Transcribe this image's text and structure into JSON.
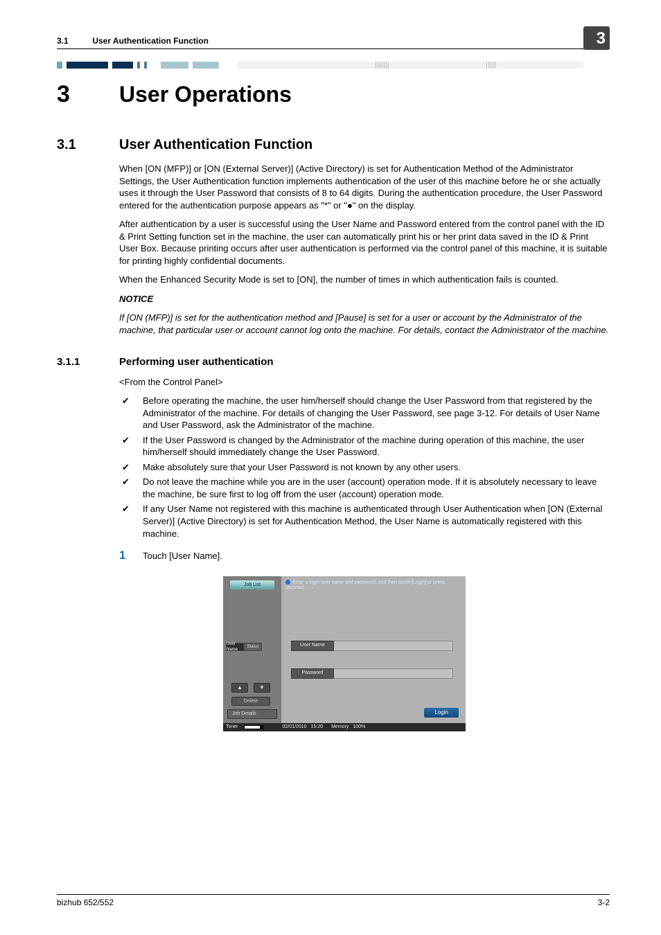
{
  "runhead": {
    "section_num": "3.1",
    "section_title": "User Authentication Function",
    "chapter_tab": "3"
  },
  "h1": {
    "num": "3",
    "title": "User Operations"
  },
  "h2": {
    "num": "3.1",
    "title": "User Authentication Function"
  },
  "para1": "When [ON (MFP)] or [ON (External Server)] (Active Directory) is set for Authentication Method of the Administrator Settings, the User Authentication function implements authentication of the user of this machine before he or she actually uses it through the User Password that consists of 8 to 64 digits. During the authentication procedure, the User Password entered for the authentication purpose appears as \"*\" or \"●\" on the display.",
  "para2": "After authentication by a user is successful using the User Name and Password entered from the control panel with the ID & Print Setting function set in the machine, the user can automatically print his or her print data saved in the ID & Print User Box. Because printing occurs after user authentication is performed via the control panel of this machine, it is suitable for printing highly confidential documents.",
  "para3": "When the Enhanced Security Mode is set to [ON], the number of times in which authentication fails is counted.",
  "notice": {
    "heading": "NOTICE",
    "body": "If [ON (MFP)] is set for the authentication method and [Pause] is set for a user or account by the Administrator of the machine, that particular user or account cannot log onto the machine. For details, contact the Administrator of the machine."
  },
  "h3": {
    "num": "3.1.1",
    "title": "Performing user authentication"
  },
  "subhead": "<From the Control Panel>",
  "bullets": [
    "Before operating the machine, the user him/herself should change the User Password from that registered by the Administrator of the machine. For details of changing the User Password, see page 3-12. For details of User Name and User Password, ask the Administrator of the machine.",
    "If the User Password is changed by the Administrator of the machine during operation of this machine, the user him/herself should immediately change the User Password.",
    "Make absolutely sure that your User Password is not known by any other users.",
    "Do not leave the machine while you are in the user (account) operation mode. If it is absolutely necessary to leave the machine, be sure first to log off from the user (account) operation mode.",
    "If any User Name not registered with this machine is authenticated through User Authentication when [ON (External Server)] (Active Directory) is set for Authentication Method, the User Name is automatically registered with this machine."
  ],
  "step": {
    "num": "1",
    "text": "Touch [User Name]."
  },
  "cpanel": {
    "job_list": "Job List",
    "tabs": {
      "user_name": "User\nName",
      "status": "Status"
    },
    "delete": "Delete",
    "job_details": "Job Details",
    "instruction": "Enter a login user name and password, and then touch [Login] or press [Access].",
    "field_user": "User Name",
    "field_pass": "Password",
    "login": "Login",
    "status": {
      "toner": "Toner",
      "date": "02/01/2010",
      "time": "15:20",
      "mem_label": "Memory",
      "mem_value": "100%"
    }
  },
  "footer": {
    "left": "bizhub 652/552",
    "right": "3-2"
  }
}
